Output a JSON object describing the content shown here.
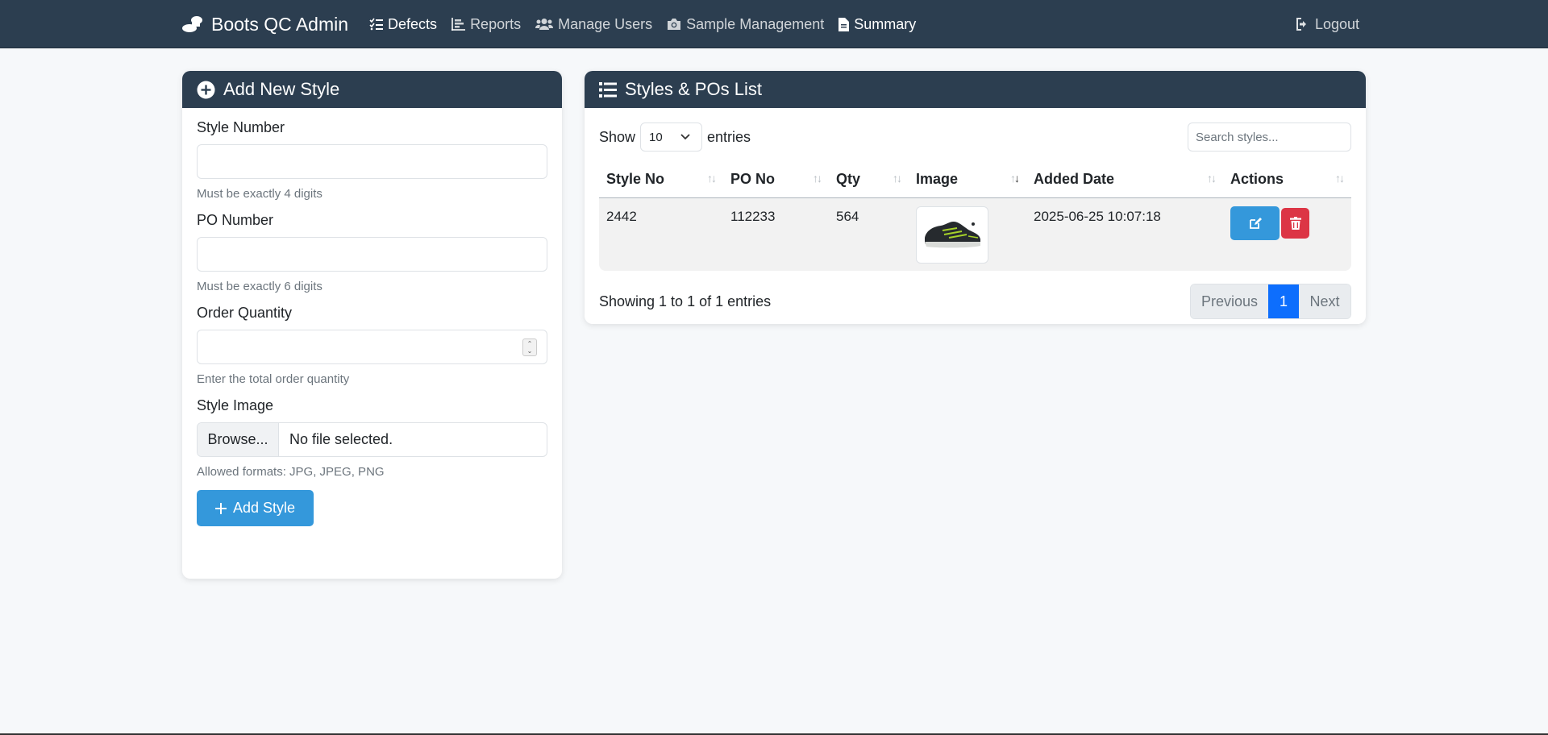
{
  "navbar": {
    "brand": "Boots QC Admin",
    "links": [
      {
        "label": "Defects",
        "icon": "list-check-icon"
      },
      {
        "label": "Reports",
        "icon": "chart-bar-icon"
      },
      {
        "label": "Manage Users",
        "icon": "users-icon"
      },
      {
        "label": "Sample Management",
        "icon": "camera-icon"
      },
      {
        "label": "Summary",
        "icon": "file-icon"
      }
    ],
    "logout": "Logout"
  },
  "form": {
    "title": "Add New Style",
    "style_number_label": "Style Number",
    "style_number_help": "Must be exactly 4 digits",
    "po_number_label": "PO Number",
    "po_number_help": "Must be exactly 6 digits",
    "order_qty_label": "Order Quantity",
    "order_qty_help": "Enter the total order quantity",
    "image_label": "Style Image",
    "browse_label": "Browse...",
    "file_status": "No file selected.",
    "image_help": "Allowed formats: JPG, JPEG, PNG",
    "submit_label": "Add Style"
  },
  "list": {
    "title": "Styles & POs List",
    "show_label": "Show",
    "entries_value": "10",
    "entries_label": "entries",
    "search_placeholder": "Search styles...",
    "columns": [
      "Style No",
      "PO No",
      "Qty",
      "Image",
      "Added Date",
      "Actions"
    ],
    "rows": [
      {
        "style_no": "2442",
        "po_no": "112233",
        "qty": "564",
        "added_date": "2025-06-25 10:07:18"
      }
    ],
    "info": "Showing 1 to 1 of 1 entries",
    "pager": {
      "previous": "Previous",
      "current": "1",
      "next": "Next"
    }
  },
  "colors": {
    "navbar": "#2c3e50",
    "primary_button": "#3498db",
    "danger": "#dc3545",
    "active_page": "#0d6efd"
  }
}
